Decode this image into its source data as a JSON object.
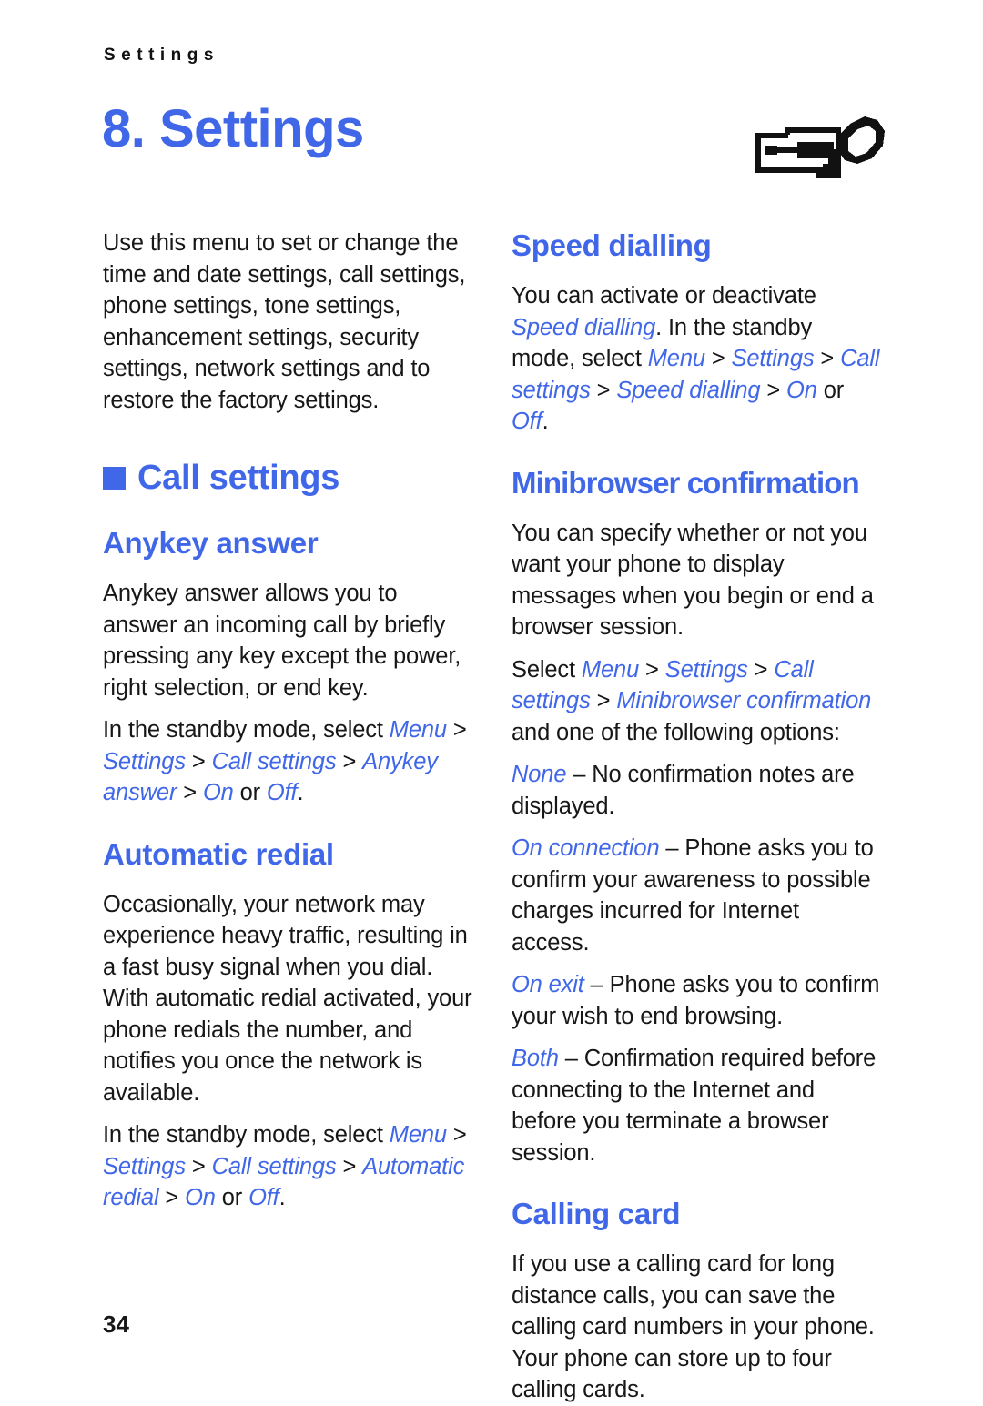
{
  "header": {
    "running_title": "Settings",
    "chapter_title": "8. Settings",
    "icon_name": "tools-settings-icon"
  },
  "colors": {
    "accent_blue": "#4067E8",
    "body_text": "#171717",
    "background": "#FFFFFF"
  },
  "left_column": {
    "intro": "Use this menu to set or change the time and date settings, call settings, phone settings, tone settings, enhancement settings, security settings, network settings and to restore the factory settings.",
    "call_settings_heading": "Call settings",
    "anykey": {
      "heading": "Anykey answer",
      "body": "Anykey answer allows you to answer an incoming call by briefly pressing any key except the power, right selection, or end key.",
      "path_lead": "In the standby mode, select ",
      "path": {
        "menu": "Menu",
        "settings": "Settings",
        "call_settings": "Call settings",
        "item": "Anykey answer",
        "on": "On",
        "or": " or ",
        "off": "Off",
        "sep": " > ",
        "period": "."
      }
    },
    "automatic_redial": {
      "heading": "Automatic redial",
      "body": "Occasionally, your network may experience heavy traffic, resulting in a fast busy signal when you dial. With automatic redial activated, your phone redials the number, and notifies you once the network is available.",
      "path_lead": "In the standby mode, select ",
      "path": {
        "menu": "Menu",
        "settings": "Settings",
        "call_settings": "Call settings",
        "item": "Automatic redial",
        "on": "On",
        "or": " or ",
        "off": "Off",
        "sep": " > ",
        "period": "."
      }
    }
  },
  "right_column": {
    "speed_dialling": {
      "heading": "Speed dialling",
      "body_part1": "You can activate or deactivate ",
      "emph": "Speed dialling",
      "body_part2": ". In the standby mode, select ",
      "path": {
        "menu": "Menu",
        "settings": "Settings",
        "call_settings": "Call settings",
        "item": "Speed dialling",
        "on": "On",
        "or": " or ",
        "off": "Off",
        "sep": " > ",
        "period": "."
      }
    },
    "minibrowser": {
      "heading": "Minibrowser confirmation",
      "body": "You can specify whether or not you want your phone to display messages when you begin or end a browser session.",
      "select_lead": "Select ",
      "path": {
        "menu": "Menu",
        "settings": "Settings",
        "call_settings": "Call settings",
        "item": "Minibrowser confirmation",
        "sep": " > "
      },
      "select_tail": " and one of the following options:",
      "options": [
        {
          "term": "None",
          "dash": " – ",
          "desc": "No confirmation notes are displayed."
        },
        {
          "term": "On connection",
          "dash": " – ",
          "desc": "Phone asks you to confirm your awareness to possible charges incurred for Internet access."
        },
        {
          "term": "On exit",
          "dash": " – ",
          "desc": "Phone asks you to confirm your wish to end browsing."
        },
        {
          "term": "Both",
          "dash": " – ",
          "desc": "Confirmation required before connecting to the Internet and before you terminate a browser session."
        }
      ]
    },
    "calling_card": {
      "heading": "Calling card",
      "body": "If you use a calling card for long distance calls, you can save the calling card numbers in your phone. Your phone can store up to four calling cards."
    }
  },
  "footer": {
    "page_number": "34"
  }
}
